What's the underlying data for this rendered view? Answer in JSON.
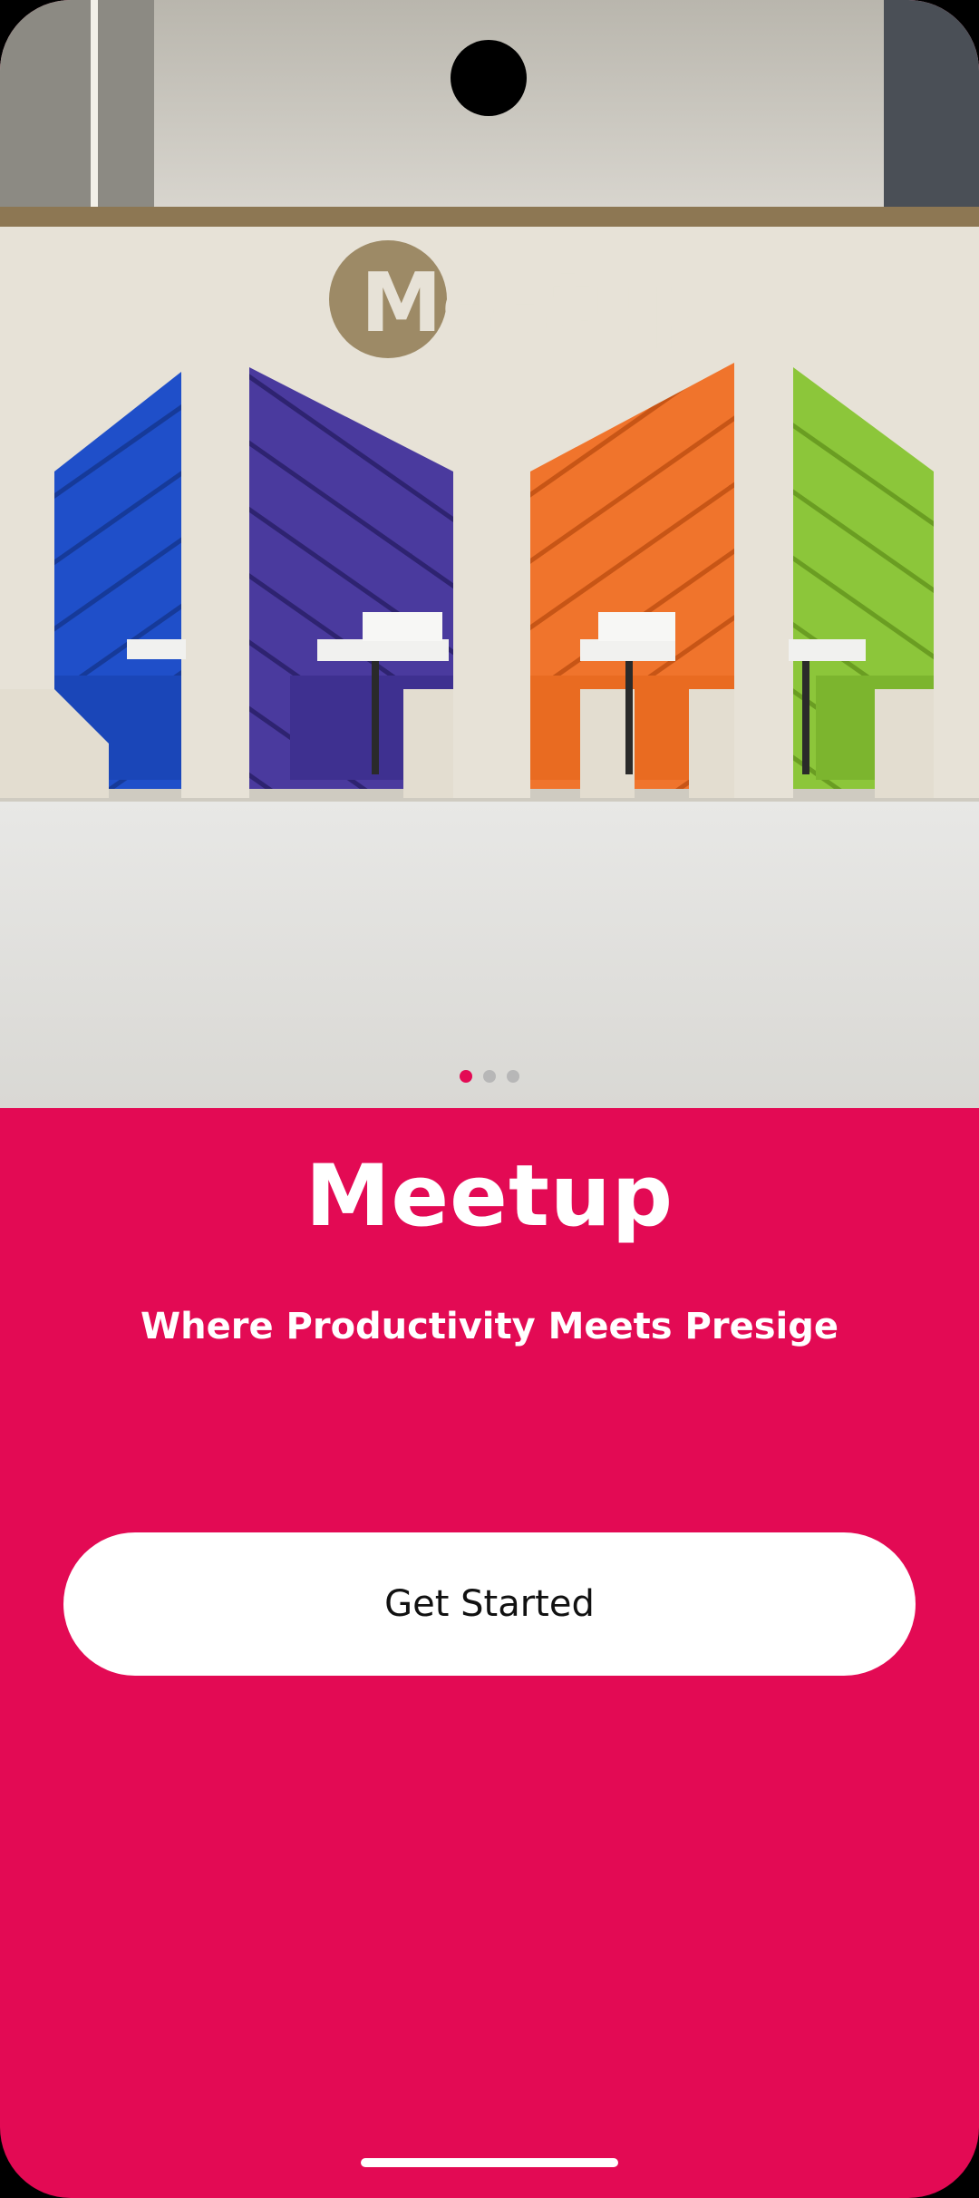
{
  "hero": {
    "sign_text": "Meetup",
    "image_alt": "colorful meeting booths"
  },
  "carousel": {
    "total": 3,
    "active": 1
  },
  "app": {
    "title": "Meetup",
    "tagline": "Where Productivity Meets Presige",
    "cta_label": "Get Started"
  },
  "colors": {
    "brand": "#E30A54",
    "button_bg": "#FFFFFF",
    "button_text": "#111111"
  }
}
